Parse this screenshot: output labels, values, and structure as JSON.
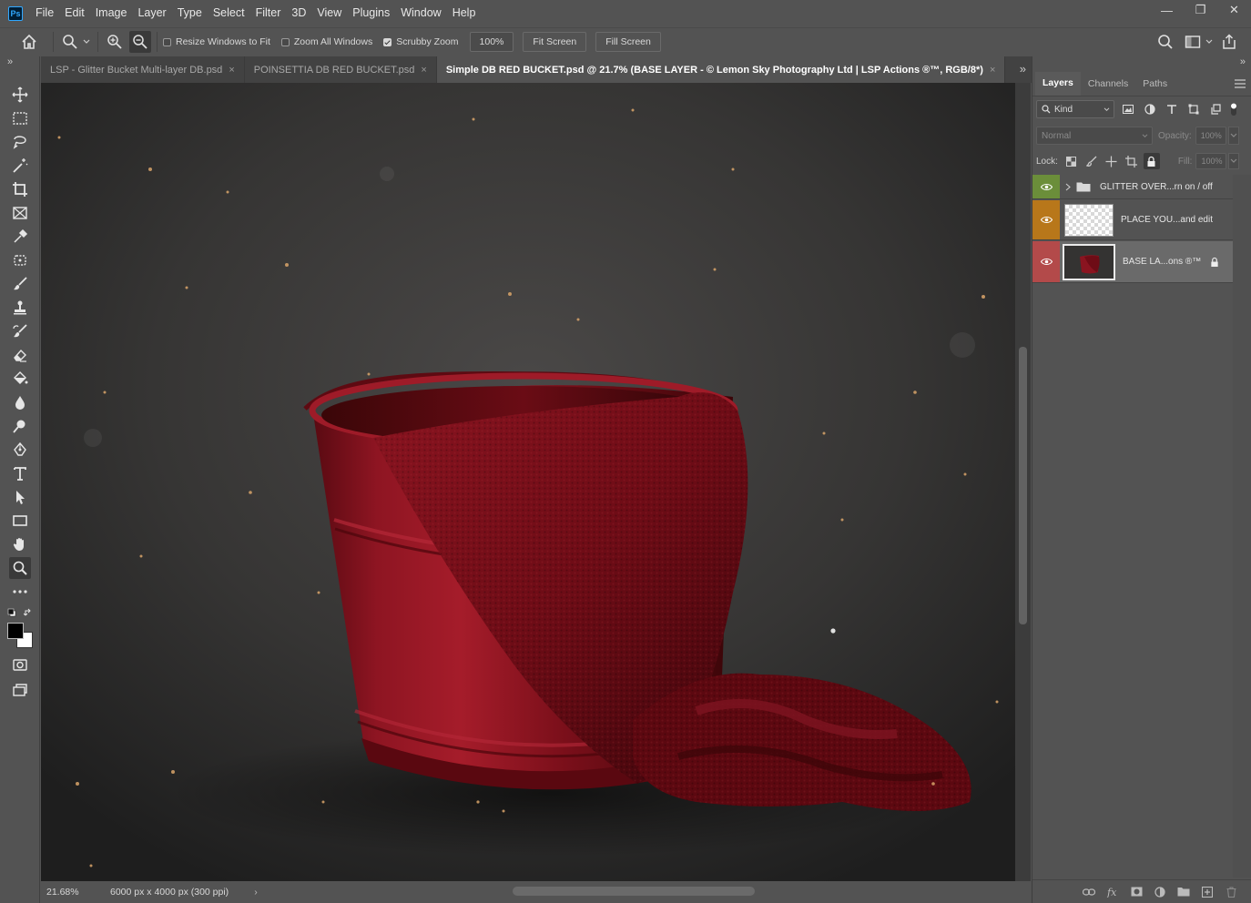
{
  "app": {
    "logo": "Ps"
  },
  "menu": [
    "File",
    "Edit",
    "Image",
    "Layer",
    "Type",
    "Select",
    "Filter",
    "3D",
    "View",
    "Plugins",
    "Window",
    "Help"
  ],
  "window_controls": {
    "minimize": "—",
    "restore": "❐",
    "close": "✕"
  },
  "options": {
    "resize_windows": {
      "label": "Resize Windows to Fit",
      "checked": false
    },
    "zoom_all": {
      "label": "Zoom All Windows",
      "checked": false
    },
    "scrubby": {
      "label": "Scrubby Zoom",
      "checked": true
    },
    "zoom_value": "100%",
    "fit_screen": "Fit Screen",
    "fill_screen": "Fill Screen"
  },
  "tabs": [
    {
      "title": "LSP - Glitter Bucket Multi-layer DB.psd",
      "active": false
    },
    {
      "title": "POINSETTIA DB RED BUCKET.psd",
      "active": false
    },
    {
      "title": "Simple DB RED BUCKET.psd @ 21.7% (BASE LAYER - © Lemon Sky Photography Ltd | LSP Actions ®™, RGB/8*)",
      "active": true
    }
  ],
  "tab_close": "×",
  "collapse_glyph": "»",
  "status": {
    "zoom": "21.68%",
    "doc_info": "6000 px x 4000 px (300 ppi)",
    "arrow": "›"
  },
  "panel": {
    "tabs": [
      "Layers",
      "Channels",
      "Paths"
    ],
    "filter_kind": "Kind",
    "blend_mode": "Normal",
    "opacity_label": "Opacity:",
    "opacity_value": "100%",
    "lock_label": "Lock:",
    "fill_label": "Fill:",
    "fill_value": "100%",
    "layers": [
      {
        "name": "GLITTER OVER...rn on / off",
        "color": "#6b8e3a",
        "type": "group"
      },
      {
        "name": "PLACE YOU...and edit",
        "color": "#b8771a",
        "type": "transparent"
      },
      {
        "name": "BASE LA...ons ®™",
        "color": "#b34a4a",
        "type": "image",
        "locked": true
      }
    ]
  },
  "colors": {
    "accent": "#31a8ff",
    "bucket": "#7a0d18"
  }
}
